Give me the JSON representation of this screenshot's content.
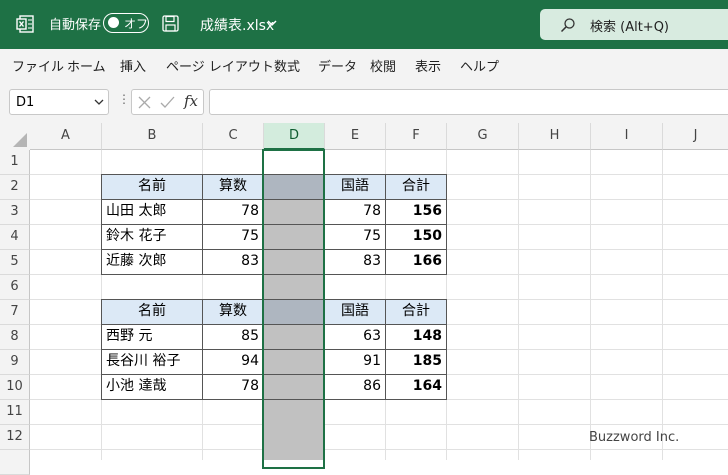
{
  "titlebar": {
    "autosave_label": "自動保存",
    "autosave_state": "オフ",
    "file_name": "成績表.xlsx",
    "search_placeholder": "検索 (Alt+Q)",
    "color": "#1e7145"
  },
  "menu": [
    "ファイル",
    "ホーム",
    "挿入",
    "ページ レイアウト",
    "数式",
    "データ",
    "校閲",
    "表示",
    "ヘルプ"
  ],
  "formula_bar": {
    "name_box": "D1",
    "fx": "fx",
    "content": ""
  },
  "columns": [
    "A",
    "B",
    "C",
    "D",
    "E",
    "F",
    "G",
    "H",
    "I",
    "J"
  ],
  "selected_column": "D",
  "rows": [
    "1",
    "2",
    "3",
    "4",
    "5",
    "6",
    "7",
    "8",
    "9",
    "10",
    "11",
    "12"
  ],
  "table1": {
    "header": {
      "name": "名前",
      "math": "算数",
      "japanese": "国語",
      "total": "合計"
    },
    "rows": [
      {
        "name": "山田 太郎",
        "math": "78",
        "japanese": "78",
        "total": "156"
      },
      {
        "name": "鈴木 花子",
        "math": "75",
        "japanese": "75",
        "total": "150"
      },
      {
        "name": "近藤 次郎",
        "math": "83",
        "japanese": "83",
        "total": "166"
      }
    ]
  },
  "table2": {
    "header": {
      "name": "名前",
      "math": "算数",
      "japanese": "国語",
      "total": "合計"
    },
    "rows": [
      {
        "name": "西野 元",
        "math": "85",
        "japanese": "63",
        "total": "148"
      },
      {
        "name": "長谷川 裕子",
        "math": "94",
        "japanese": "91",
        "total": "185"
      },
      {
        "name": "小池 達哉",
        "math": "78",
        "japanese": "86",
        "total": "164"
      }
    ]
  },
  "watermark": "Buzzword Inc."
}
